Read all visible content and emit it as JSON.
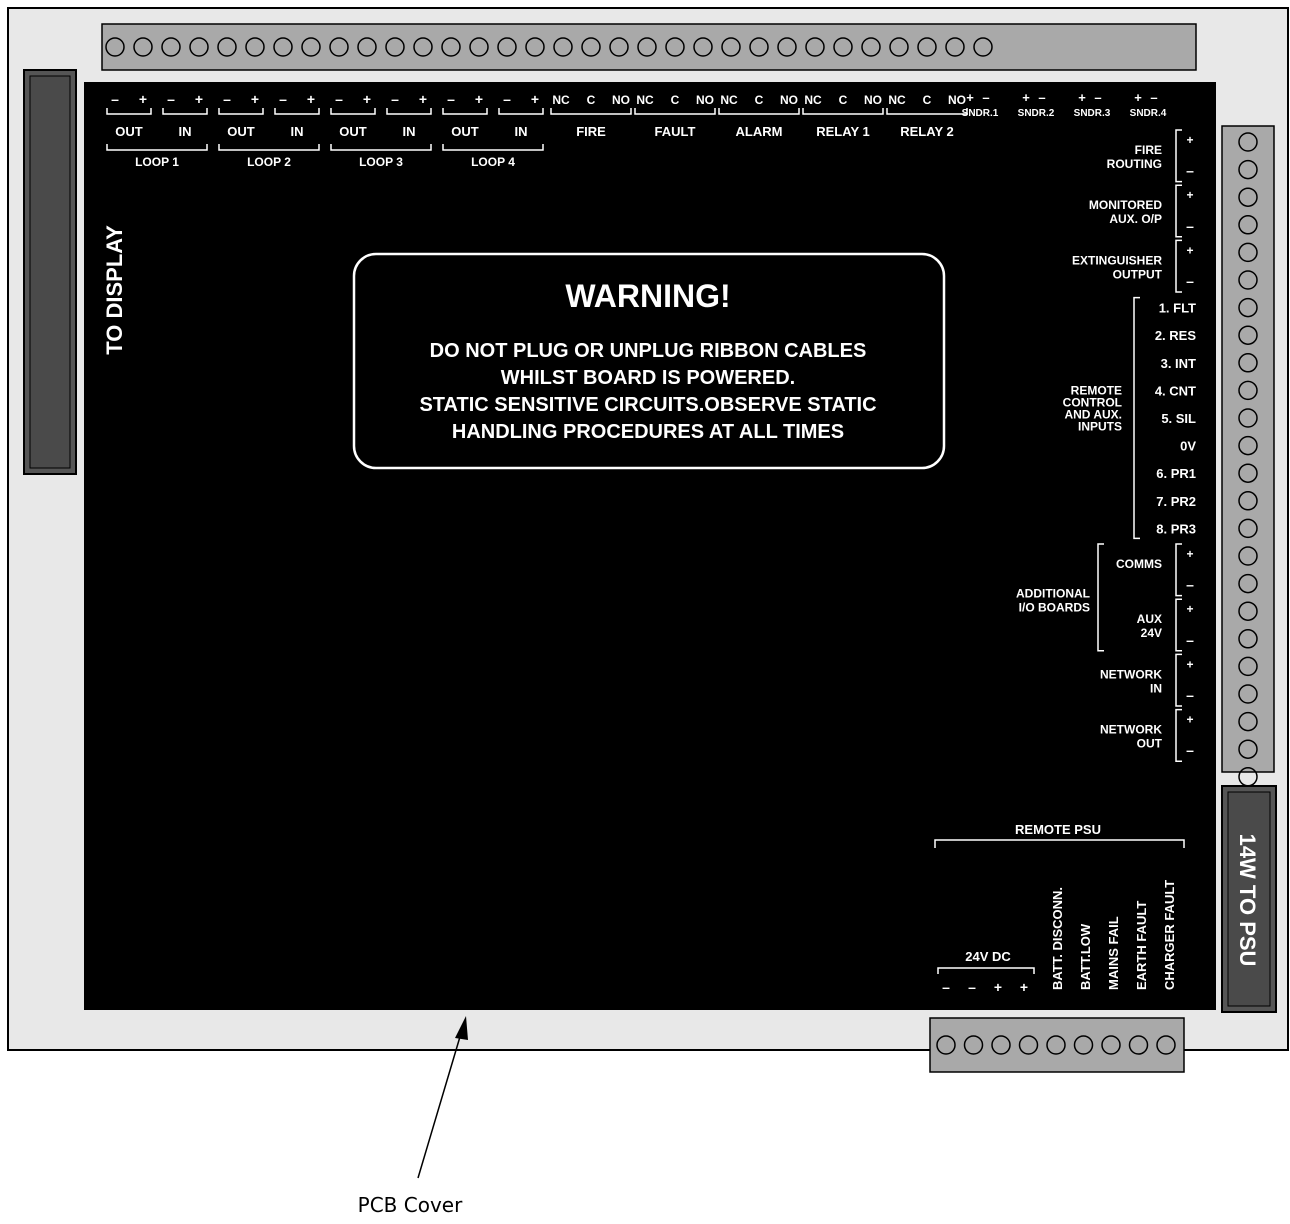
{
  "colors": {
    "board": "#e8e8e8",
    "cover": "#000000",
    "terminal_strip": "#a9a9a9",
    "connector": "#555555",
    "label_text": "#ffffff"
  },
  "icons": {
    "terminal": "circle-terminal",
    "arrow": "callout-arrow"
  },
  "left_connector_label": "TO DISPLAY",
  "right_connector_label": "14W TO PSU",
  "warning": {
    "title": "WARNING!",
    "lines": [
      "DO NOT PLUG OR UNPLUG RIBBON CABLES",
      "WHILST BOARD IS POWERED.",
      "STATIC SENSITIVE CIRCUITS.OBSERVE STATIC",
      "HANDLING PROCEDURES AT ALL TIMES"
    ]
  },
  "top_terminals": {
    "count": 32,
    "loops": [
      {
        "name": "LOOP 1",
        "sub": [
          "OUT",
          "IN"
        ],
        "pol": [
          "–",
          "+",
          "–",
          "+"
        ]
      },
      {
        "name": "LOOP 2",
        "sub": [
          "OUT",
          "IN"
        ],
        "pol": [
          "–",
          "+",
          "–",
          "+"
        ]
      },
      {
        "name": "LOOP 3",
        "sub": [
          "OUT",
          "IN"
        ],
        "pol": [
          "–",
          "+",
          "–",
          "+"
        ]
      },
      {
        "name": "LOOP 4",
        "sub": [
          "OUT",
          "IN"
        ],
        "pol": [
          "–",
          "+",
          "–",
          "+"
        ]
      }
    ],
    "relays": [
      {
        "name": "FIRE",
        "pins": [
          "NC",
          "C",
          "NO"
        ]
      },
      {
        "name": "FAULT",
        "pins": [
          "NC",
          "C",
          "NO"
        ]
      },
      {
        "name": "ALARM",
        "pins": [
          "NC",
          "C",
          "NO"
        ]
      },
      {
        "name": "RELAY 1",
        "pins": [
          "NC",
          "C",
          "NO"
        ]
      },
      {
        "name": "RELAY 2",
        "pins": [
          "NC",
          "C",
          "NO"
        ]
      }
    ],
    "sounders": [
      {
        "name": "SNDR.1",
        "pol": [
          "+",
          "–"
        ]
      },
      {
        "name": "SNDR.2",
        "pol": [
          "+",
          "–"
        ]
      },
      {
        "name": "SNDR.3",
        "pol": [
          "+",
          "–"
        ]
      },
      {
        "name": "SNDR.4",
        "pol": [
          "+",
          "–"
        ]
      }
    ]
  },
  "right_terminals": {
    "count": 24,
    "pairs": [
      {
        "label": [
          "FIRE",
          "ROUTING"
        ]
      },
      {
        "label": [
          "MONITORED",
          "AUX. O/P"
        ]
      },
      {
        "label": [
          "EXTINGUISHER",
          "OUTPUT"
        ]
      }
    ],
    "remote_inputs": {
      "group_label": [
        "REMOTE",
        "CONTROL",
        "AND AUX.",
        "INPUTS"
      ],
      "items": [
        "1.  FLT",
        "2.  RES",
        "3.   INT",
        "4.  CNT",
        "5.   SIL",
        "0V",
        "6.  PR1",
        "7.  PR2",
        "8.  PR3"
      ]
    },
    "additional_io": {
      "group_label": [
        "ADDITIONAL",
        "I/O BOARDS"
      ],
      "comms": "COMMS",
      "aux": [
        "AUX",
        "24V"
      ]
    },
    "network_in": [
      "NETWORK",
      "IN"
    ],
    "network_out": [
      "NETWORK",
      "OUT"
    ],
    "plus": "+",
    "minus": "–"
  },
  "bottom_terminals": {
    "count": 9,
    "remote_psu": "REMOTE PSU",
    "supply": "24V DC",
    "supply_pol": [
      "–",
      "–",
      "+",
      "+"
    ],
    "signals": [
      "BATT. DISCONN.",
      "BATT.LOW",
      "MAINS FAIL",
      "EARTH FAULT",
      "CHARGER FAULT"
    ]
  },
  "callout": "PCB Cover"
}
